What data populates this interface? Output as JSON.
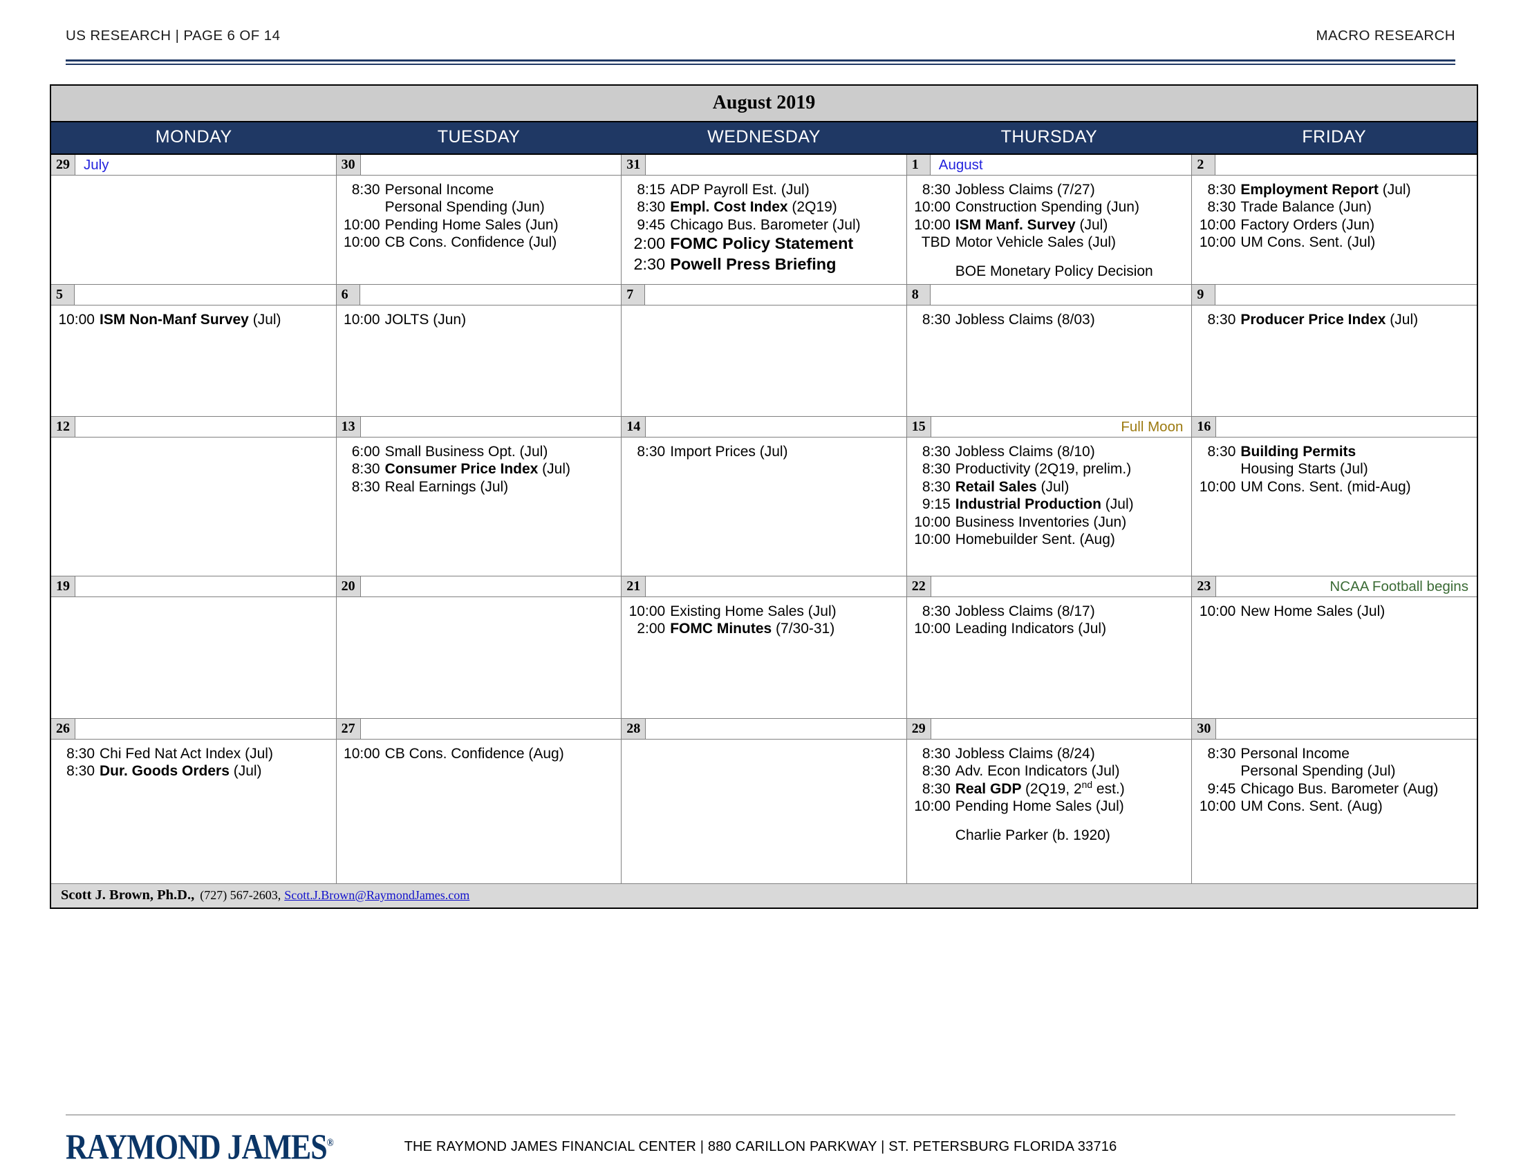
{
  "header": {
    "left": "US RESEARCH | PAGE 6 OF 14",
    "right": "MACRO RESEARCH"
  },
  "calendar": {
    "title": "August 2019",
    "day_names": [
      "MONDAY",
      "TUESDAY",
      "WEDNESDAY",
      "THURSDAY",
      "FRIDAY"
    ],
    "colors": {
      "header_band": "#1f3864",
      "title_band": "#cccccc",
      "day_number_box": "#d9d9d9",
      "month_label": "#2222dd",
      "full_moon": "#9c7a10",
      "ncaa": "#3b6b35",
      "email_link": "#1111cc",
      "logo": "#0b3566"
    },
    "weeks": [
      {
        "days": [
          {
            "num": "29",
            "note": "July",
            "note_class": "note-month",
            "note_align": "left",
            "events": []
          },
          {
            "num": "30",
            "note": "",
            "events": [
              {
                "time": "8:30",
                "parts": [
                  {
                    "t": "Personal Income",
                    "b": false
                  }
                ]
              },
              {
                "time": "",
                "parts": [
                  {
                    "t": "Personal Spending (Jun)",
                    "b": false
                  }
                ],
                "indent": true
              },
              {
                "time": "10:00",
                "parts": [
                  {
                    "t": "Pending Home Sales (Jun)",
                    "b": false
                  }
                ]
              },
              {
                "time": "10:00",
                "parts": [
                  {
                    "t": "CB Cons. Confidence (Jul)",
                    "b": false
                  }
                ]
              }
            ]
          },
          {
            "num": "31",
            "note": "",
            "events": [
              {
                "time": "8:15",
                "parts": [
                  {
                    "t": "ADP Payroll Est. (Jul)",
                    "b": false
                  }
                ]
              },
              {
                "time": "8:30",
                "parts": [
                  {
                    "t": "Empl. Cost Index ",
                    "b": true
                  },
                  {
                    "t": "(2Q19)",
                    "b": false
                  }
                ]
              },
              {
                "time": "9:45",
                "parts": [
                  {
                    "t": "Chicago Bus. Barometer (Jul)",
                    "b": false
                  }
                ]
              },
              {
                "time": "2:00",
                "parts": [
                  {
                    "t": "FOMC Policy Statement",
                    "b": true
                  }
                ],
                "big": true
              },
              {
                "time": "2:30",
                "parts": [
                  {
                    "t": "Powell Press Briefing",
                    "b": true
                  }
                ],
                "big": true
              }
            ]
          },
          {
            "num": "1",
            "note": "August",
            "note_class": "note-month",
            "note_align": "left",
            "events": [
              {
                "time": "8:30",
                "parts": [
                  {
                    "t": "Jobless Claims (7/27)",
                    "b": false
                  }
                ]
              },
              {
                "time": "10:00",
                "parts": [
                  {
                    "t": "Construction Spending (Jun)",
                    "b": false
                  }
                ]
              },
              {
                "time": "10:00",
                "parts": [
                  {
                    "t": "ISM Manf. Survey ",
                    "b": true
                  },
                  {
                    "t": "(Jul)",
                    "b": false
                  }
                ]
              },
              {
                "time": "TBD",
                "parts": [
                  {
                    "t": " Motor Vehicle Sales (Jul)",
                    "b": false
                  }
                ]
              },
              {
                "time": "",
                "parts": [],
                "spacer": true
              },
              {
                "time": "",
                "parts": [
                  {
                    "t": "BOE Monetary Policy Decision",
                    "b": false
                  }
                ],
                "nopad": true
              }
            ]
          },
          {
            "num": "2",
            "note": "",
            "events": [
              {
                "time": "8:30",
                "parts": [
                  {
                    "t": "Employment Report ",
                    "b": true
                  },
                  {
                    "t": "(Jul)",
                    "b": false
                  }
                ]
              },
              {
                "time": "8:30",
                "parts": [
                  {
                    "t": "Trade Balance (Jun)",
                    "b": false
                  }
                ]
              },
              {
                "time": "10:00",
                "parts": [
                  {
                    "t": "Factory Orders (Jun)",
                    "b": false
                  }
                ]
              },
              {
                "time": "10:00",
                "parts": [
                  {
                    "t": "UM Cons. Sent. (Jul)",
                    "b": false
                  }
                ]
              }
            ]
          }
        ]
      },
      {
        "days": [
          {
            "num": "5",
            "note": "",
            "events": [
              {
                "time": "10:00",
                "parts": [
                  {
                    "t": "ISM Non-Manf Survey ",
                    "b": true
                  },
                  {
                    "t": "(Jul)",
                    "b": false
                  }
                ]
              }
            ]
          },
          {
            "num": "6",
            "note": "",
            "events": [
              {
                "time": "10:00",
                "parts": [
                  {
                    "t": "JOLTS (Jun)",
                    "b": false
                  }
                ]
              }
            ]
          },
          {
            "num": "7",
            "note": "",
            "events": []
          },
          {
            "num": "8",
            "note": "",
            "events": [
              {
                "time": "8:30",
                "parts": [
                  {
                    "t": "Jobless Claims (8/03)",
                    "b": false
                  }
                ]
              }
            ]
          },
          {
            "num": "9",
            "note": "",
            "events": [
              {
                "time": "8:30",
                "parts": [
                  {
                    "t": "Producer Price Index ",
                    "b": true
                  },
                  {
                    "t": "(Jul)",
                    "b": false
                  }
                ]
              }
            ]
          }
        ]
      },
      {
        "days": [
          {
            "num": "12",
            "note": "",
            "events": []
          },
          {
            "num": "13",
            "note": "",
            "events": [
              {
                "time": "6:00",
                "parts": [
                  {
                    "t": "Small Business Opt. (Jul)",
                    "b": false
                  }
                ]
              },
              {
                "time": "8:30",
                "parts": [
                  {
                    "t": "Consumer Price Index ",
                    "b": true
                  },
                  {
                    "t": "(Jul)",
                    "b": false
                  }
                ]
              },
              {
                "time": "8:30",
                "parts": [
                  {
                    "t": "Real Earnings (Jul)",
                    "b": false
                  }
                ]
              }
            ]
          },
          {
            "num": "14",
            "note": "",
            "events": [
              {
                "time": "8:30",
                "parts": [
                  {
                    "t": "Import Prices (Jul)",
                    "b": false
                  }
                ]
              }
            ]
          },
          {
            "num": "15",
            "note": "Full Moon",
            "note_class": "note-moon",
            "note_align": "right",
            "events": [
              {
                "time": "8:30",
                "parts": [
                  {
                    "t": "Jobless Claims (8/10)",
                    "b": false
                  }
                ]
              },
              {
                "time": "8:30",
                "parts": [
                  {
                    "t": "Productivity (2Q19, prelim.)",
                    "b": false
                  }
                ]
              },
              {
                "time": "8:30",
                "parts": [
                  {
                    "t": "Retail Sales ",
                    "b": true
                  },
                  {
                    "t": "(Jul)",
                    "b": false
                  }
                ]
              },
              {
                "time": "9:15",
                "parts": [
                  {
                    "t": "Industrial Production ",
                    "b": true
                  },
                  {
                    "t": "(Jul)",
                    "b": false
                  }
                ]
              },
              {
                "time": "10:00",
                "parts": [
                  {
                    "t": "Business Inventories (Jun)",
                    "b": false
                  }
                ]
              },
              {
                "time": "10:00",
                "parts": [
                  {
                    "t": "Homebuilder Sent. (Aug)",
                    "b": false
                  }
                ]
              }
            ]
          },
          {
            "num": "16",
            "note": "",
            "events": [
              {
                "time": "8:30",
                "parts": [
                  {
                    "t": "Building Permits",
                    "b": true
                  }
                ]
              },
              {
                "time": "",
                "parts": [
                  {
                    "t": "Housing Starts (Jul)",
                    "b": false
                  }
                ],
                "indent": true
              },
              {
                "time": "10:00",
                "parts": [
                  {
                    "t": "UM Cons. Sent. (mid-Aug)",
                    "b": false
                  }
                ]
              }
            ]
          }
        ]
      },
      {
        "days": [
          {
            "num": "19",
            "note": "",
            "events": []
          },
          {
            "num": "20",
            "note": "",
            "events": []
          },
          {
            "num": "21",
            "note": "",
            "events": [
              {
                "time": "10:00",
                "parts": [
                  {
                    "t": "Existing Home Sales (Jul)",
                    "b": false
                  }
                ]
              },
              {
                "time": "2:00",
                "parts": [
                  {
                    "t": "FOMC Minutes ",
                    "b": true
                  },
                  {
                    "t": "(7/30-31)",
                    "b": false
                  }
                ]
              }
            ]
          },
          {
            "num": "22",
            "note": "",
            "events": [
              {
                "time": "8:30",
                "parts": [
                  {
                    "t": "Jobless Claims (8/17)",
                    "b": false
                  }
                ]
              },
              {
                "time": "10:00",
                "parts": [
                  {
                    "t": "Leading Indicators (Jul)",
                    "b": false
                  }
                ]
              }
            ]
          },
          {
            "num": "23",
            "note": "NCAA Football begins",
            "note_class": "note-ncaa",
            "note_align": "right",
            "events": [
              {
                "time": "10:00",
                "parts": [
                  {
                    "t": "New Home Sales (Jul)",
                    "b": false
                  }
                ]
              }
            ]
          }
        ]
      },
      {
        "days": [
          {
            "num": "26",
            "note": "",
            "events": [
              {
                "time": "8:30",
                "parts": [
                  {
                    "t": "Chi Fed Nat Act Index (Jul)",
                    "b": false
                  }
                ]
              },
              {
                "time": "8:30",
                "parts": [
                  {
                    "t": "Dur. Goods Orders ",
                    "b": true
                  },
                  {
                    "t": "(Jul)",
                    "b": false
                  }
                ]
              }
            ]
          },
          {
            "num": "27",
            "note": "",
            "events": [
              {
                "time": "10:00",
                "parts": [
                  {
                    "t": "CB Cons. Confidence (Aug)",
                    "b": false
                  }
                ]
              }
            ]
          },
          {
            "num": "28",
            "note": "",
            "events": []
          },
          {
            "num": "29",
            "note": "",
            "events": [
              {
                "time": "8:30",
                "parts": [
                  {
                    "t": "Jobless Claims (8/24)",
                    "b": false
                  }
                ]
              },
              {
                "time": "8:30",
                "parts": [
                  {
                    "t": "Adv. Econ Indicators (Jul)",
                    "b": false
                  }
                ]
              },
              {
                "time": "8:30",
                "parts": [
                  {
                    "t": "Real GDP ",
                    "b": true
                  },
                  {
                    "t": "(2Q19, 2",
                    "b": false
                  },
                  {
                    "t": "nd",
                    "sup": true
                  },
                  {
                    "t": " est.)",
                    "b": false
                  }
                ]
              },
              {
                "time": "10:00",
                "parts": [
                  {
                    "t": "Pending Home Sales (Jul)",
                    "b": false
                  }
                ]
              },
              {
                "time": "",
                "parts": [],
                "spacer": true
              },
              {
                "time": "",
                "parts": [
                  {
                    "t": " Charlie Parker (b. 1920)",
                    "b": false
                  }
                ],
                "nopad": true
              }
            ]
          },
          {
            "num": "30",
            "note": "",
            "events": [
              {
                "time": "8:30",
                "parts": [
                  {
                    "t": "Personal Income",
                    "b": false
                  }
                ]
              },
              {
                "time": "",
                "parts": [
                  {
                    "t": "Personal Spending (Jul)",
                    "b": false
                  }
                ],
                "indent": true
              },
              {
                "time": "9:45",
                "parts": [
                  {
                    "t": "Chicago Bus. Barometer (Aug)",
                    "b": false
                  }
                ]
              },
              {
                "time": "10:00",
                "parts": [
                  {
                    "t": "UM Cons. Sent. (Aug)",
                    "b": false
                  }
                ]
              }
            ]
          }
        ]
      }
    ],
    "analyst": {
      "name": "Scott J. Brown, Ph.D.,",
      "phone": "(727) 567-2603,",
      "email": "Scott.J.Brown@RaymondJames.com"
    }
  },
  "footer": {
    "logo": "RAYMOND JAMES",
    "address": "THE RAYMOND JAMES FINANCIAL CENTER | 880 CARILLON PARKWAY | ST. PETERSBURG FLORIDA 33716"
  }
}
